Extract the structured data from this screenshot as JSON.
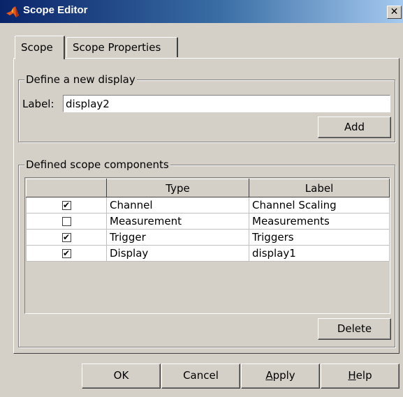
{
  "window": {
    "title": "Scope Editor",
    "close_glyph": "✕",
    "icon": "matlab-logo-icon",
    "titlebar_gradient": [
      "#0a246a",
      "#a6caf0"
    ],
    "face_color": "#d4d0c8"
  },
  "tabs": [
    {
      "label": "Scope",
      "selected": true
    },
    {
      "label": "Scope Properties",
      "selected": false
    }
  ],
  "new_display": {
    "group_label": "Define a new display",
    "label_caption": "Label:",
    "label_value": "display2",
    "add_label": "Add"
  },
  "components": {
    "group_label": "Defined scope components",
    "columns": [
      "",
      "Type",
      "Label"
    ],
    "rows": [
      {
        "checked": true,
        "type": "Channel",
        "label": "Channel Scaling"
      },
      {
        "checked": false,
        "type": "Measurement",
        "label": "Measurements"
      },
      {
        "checked": true,
        "type": "Trigger",
        "label": "Triggers"
      },
      {
        "checked": true,
        "type": "Display",
        "label": "display1"
      }
    ],
    "delete_label": "Delete"
  },
  "footer": {
    "ok_label": "OK",
    "cancel_label": "Cancel",
    "apply_mnemonic": "A",
    "apply_rest": "pply",
    "help_mnemonic": "H",
    "help_rest": "elp"
  }
}
